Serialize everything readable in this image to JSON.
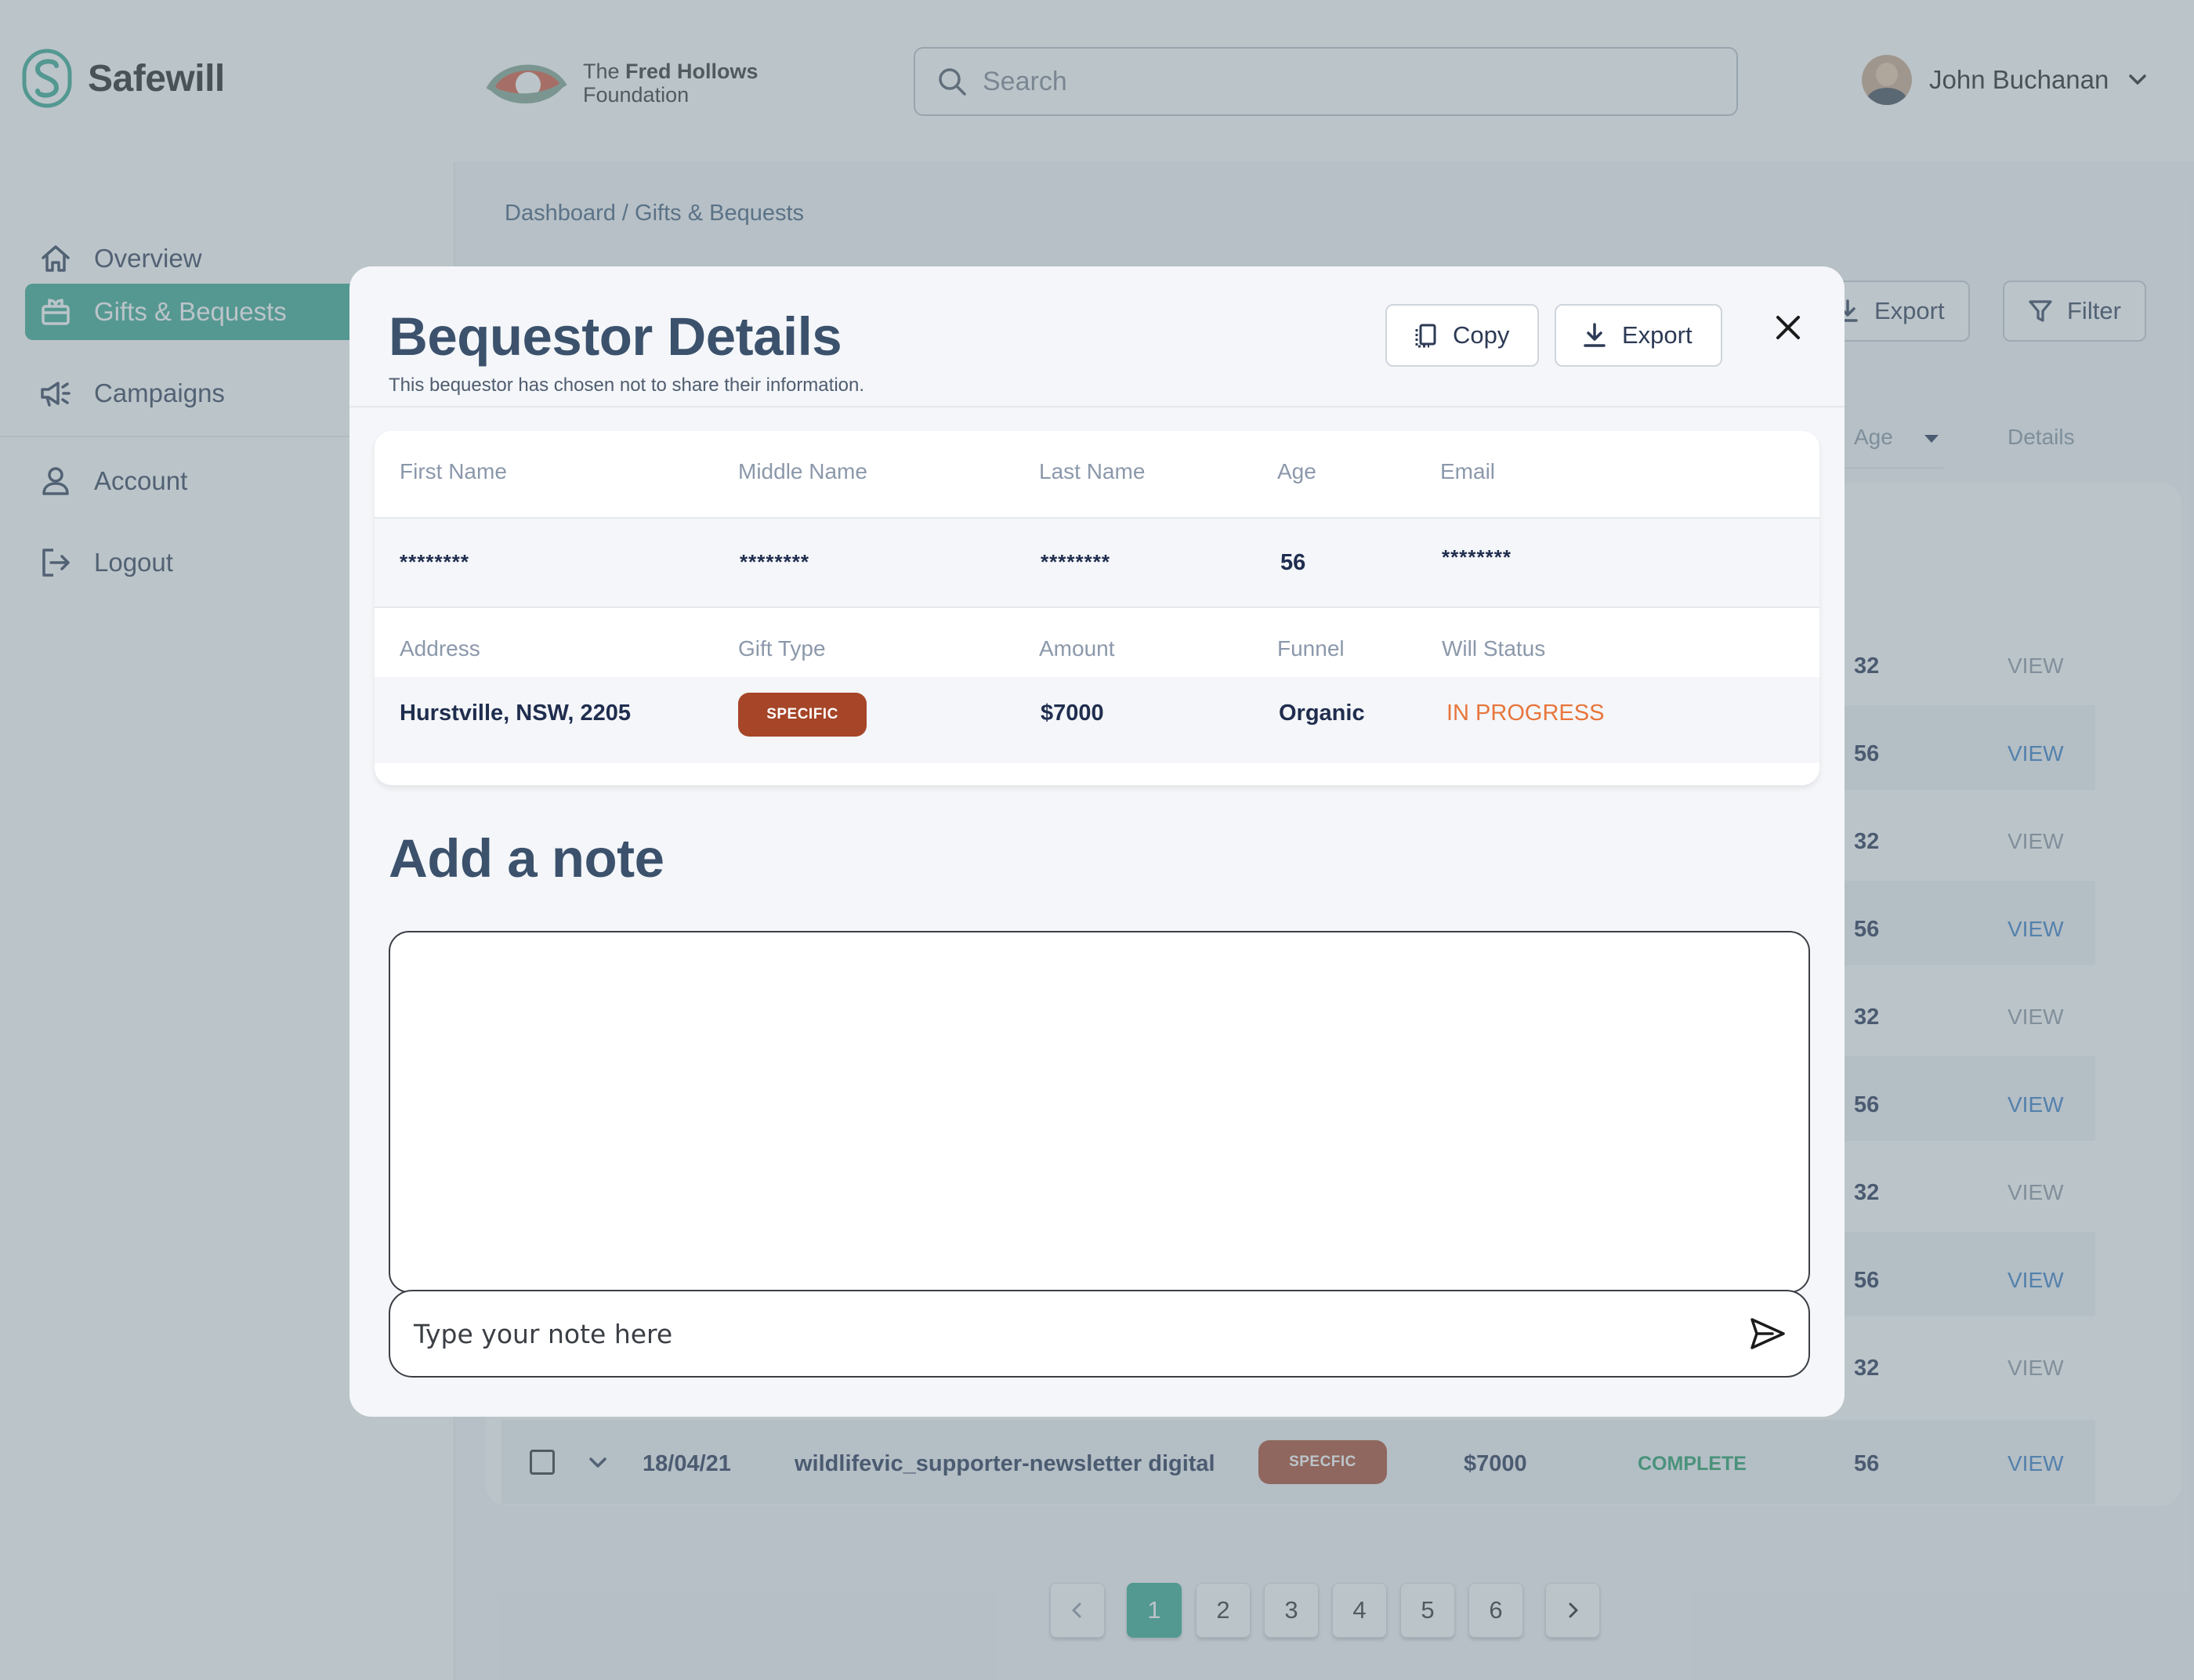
{
  "brand": {
    "name": "Safewill"
  },
  "partner": {
    "line1_prefix": "The ",
    "line1_bold": "Fred Hollows",
    "line2": "Foundation"
  },
  "search": {
    "placeholder": "Search"
  },
  "user": {
    "name": "John Buchanan"
  },
  "sidebar": {
    "items": [
      {
        "label": "Overview",
        "icon": "home-icon"
      },
      {
        "label": "Gifts & Bequests",
        "icon": "gift-icon",
        "active": true
      },
      {
        "label": "Campaigns",
        "icon": "megaphone-icon"
      },
      {
        "label": "Account",
        "icon": "person-icon"
      },
      {
        "label": "Logout",
        "icon": "logout-icon"
      }
    ]
  },
  "main": {
    "breadcrumb": "Dashboard / Gifts & Bequests",
    "export_label": "Export",
    "filter_label": "Filter",
    "table": {
      "headers": {
        "age": "Age",
        "details": "Details"
      },
      "rows": [
        {
          "age": "32",
          "details": "VIEW",
          "highlight": false
        },
        {
          "age": "56",
          "details": "VIEW",
          "highlight": true
        },
        {
          "age": "32",
          "details": "VIEW",
          "highlight": false
        },
        {
          "age": "56",
          "details": "VIEW",
          "highlight": true
        },
        {
          "age": "32",
          "details": "VIEW",
          "highlight": false
        },
        {
          "age": "56",
          "details": "VIEW",
          "highlight": true
        },
        {
          "age": "32",
          "details": "VIEW",
          "highlight": false
        },
        {
          "age": "56",
          "details": "VIEW",
          "highlight": true
        },
        {
          "age": "32",
          "details": "VIEW",
          "highlight": false
        }
      ],
      "last_row": {
        "date": "18/04/21",
        "campaign": "wildlifevic_supporter-newsletter digital",
        "gift_type": "SPECFIC",
        "amount": "$7000",
        "status": "COMPLETE",
        "age": "56",
        "details": "VIEW"
      }
    },
    "pagination": {
      "pages": [
        "1",
        "2",
        "3",
        "4",
        "5",
        "6"
      ],
      "current": "1"
    }
  },
  "modal": {
    "title": "Bequestor Details",
    "subtitle": "This bequestor has chosen not to share their information.",
    "copy_label": "Copy",
    "export_label": "Export",
    "fields": {
      "first_name": {
        "label": "First Name",
        "value": "********"
      },
      "middle_name": {
        "label": "Middle Name",
        "value": "********"
      },
      "last_name": {
        "label": "Last Name",
        "value": "********"
      },
      "age": {
        "label": "Age",
        "value": "56"
      },
      "email": {
        "label": "Email",
        "value": "********"
      },
      "address": {
        "label": "Address",
        "value": "Hurstville, NSW, 2205"
      },
      "gift_type": {
        "label": "Gift Type",
        "value": "SPECIFIC"
      },
      "amount": {
        "label": "Amount",
        "value": "$7000"
      },
      "funnel": {
        "label": "Funnel",
        "value": "Organic"
      },
      "will_status": {
        "label": "Will Status",
        "value": "IN PROGRESS"
      }
    },
    "note": {
      "title": "Add a note",
      "placeholder": "Type your note here"
    }
  },
  "colors": {
    "accent": "#33a68f",
    "gift_pill": "#a64528",
    "in_progress": "#e8753b",
    "complete": "#1d9a62",
    "link": "#2f78c4",
    "heading": "#3b516c"
  }
}
